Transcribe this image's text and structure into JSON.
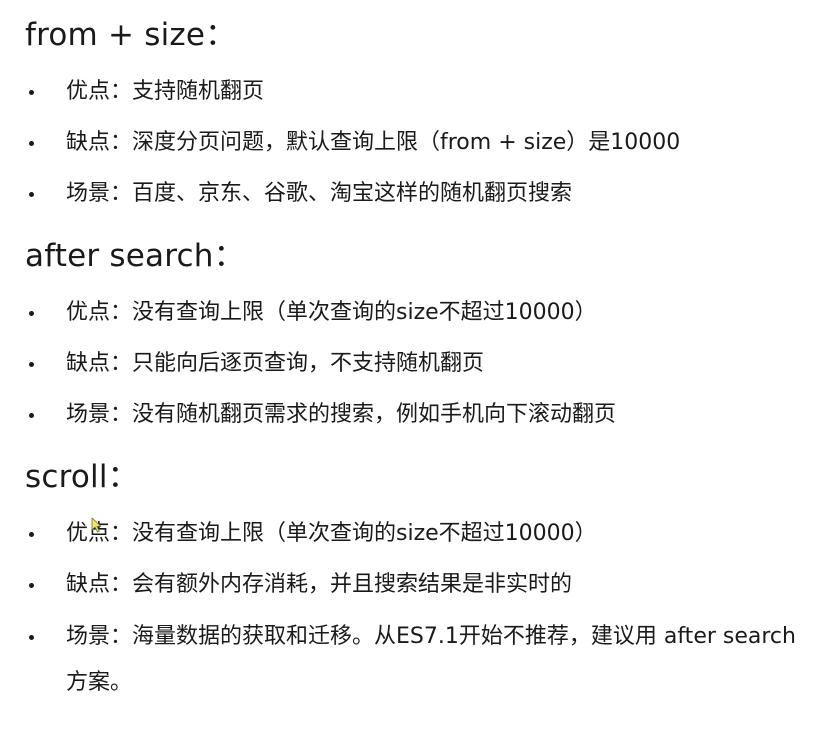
{
  "sections": [
    {
      "heading": "from + size：",
      "items": [
        {
          "text": "优点：支持随机翻页"
        },
        {
          "text": "缺点：深度分页问题，默认查询上限（from + size）是10000"
        },
        {
          "text": "场景：百度、京东、谷歌、淘宝这样的随机翻页搜索"
        }
      ]
    },
    {
      "heading": "after search：",
      "items": [
        {
          "text": "优点：没有查询上限（单次查询的size不超过10000）"
        },
        {
          "text": "缺点：只能向后逐页查询，不支持随机翻页"
        },
        {
          "text": "场景：没有随机翻页需求的搜索，例如手机向下滚动翻页"
        }
      ]
    },
    {
      "heading": "scroll：",
      "items": [
        {
          "text": "优点：没有查询上限（单次查询的size不超过10000）"
        },
        {
          "text": "缺点：会有额外内存消耗，并且搜索结果是非实时的"
        },
        {
          "text": "场景：海量数据的获取和迁移。从ES7.1开始不推荐，建议用 after search方案。"
        }
      ]
    }
  ],
  "cursor": {
    "icon": "mouse-pointer-icon",
    "color": "#f5e66a"
  }
}
